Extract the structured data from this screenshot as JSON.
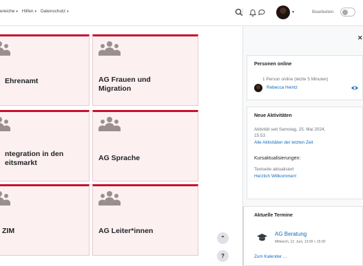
{
  "nav": {
    "items": [
      {
        "label": "ereiche",
        "caret": "▾"
      },
      {
        "label": "Hilfen",
        "caret": "▾"
      },
      {
        "label": "Datenschutz",
        "caret": "▾"
      }
    ],
    "edit_label": "Bearbeiten",
    "edit_mode_on": false,
    "avatar_caret": "▾"
  },
  "cards": [
    {
      "title_line1": "Ehrenamt",
      "title_line2": ""
    },
    {
      "title_line1": "AG Frauen und",
      "title_line2": "Migration"
    },
    {
      "title_line1": "ntegration in den",
      "title_line2": "eitsmarkt"
    },
    {
      "title_line1": "AG Sprache",
      "title_line2": ""
    },
    {
      "title_line1": "ZIM",
      "title_line2": ""
    },
    {
      "title_line1": "AG Leiter*innen",
      "title_line2": ""
    }
  ],
  "drawer": {
    "close": "✕",
    "online": {
      "heading": "Personen online",
      "summary": "1 Person online (letzte 5 Minuten)",
      "user": "Rebecca Heintz"
    },
    "activity": {
      "heading": "Neue Aktivitäten",
      "since_line1": "Aktivität seit Samstag, 25. Mai 2024,",
      "since_line2": "15:53",
      "all_link": "Alle Aktivitäten der letzten Zeit",
      "updates_heading": "Kursaktualisierungen:",
      "updates_text": "Textseite aktualisiert",
      "updates_link": "Herzlich Willkommen!"
    },
    "events": {
      "heading": "Aktuelle Termine",
      "event_title": "AG Beratung",
      "event_when": "Mittwoch, 12. Juni, 13:00 » 15:00",
      "calendar_link": "Zum Kalender ..."
    }
  },
  "buttons": {
    "scroll_top": "⌃",
    "help": "?"
  },
  "colors": {
    "accent": "#c8102e",
    "card_bg": "#fdf0f1",
    "link": "#0f6cbf"
  }
}
